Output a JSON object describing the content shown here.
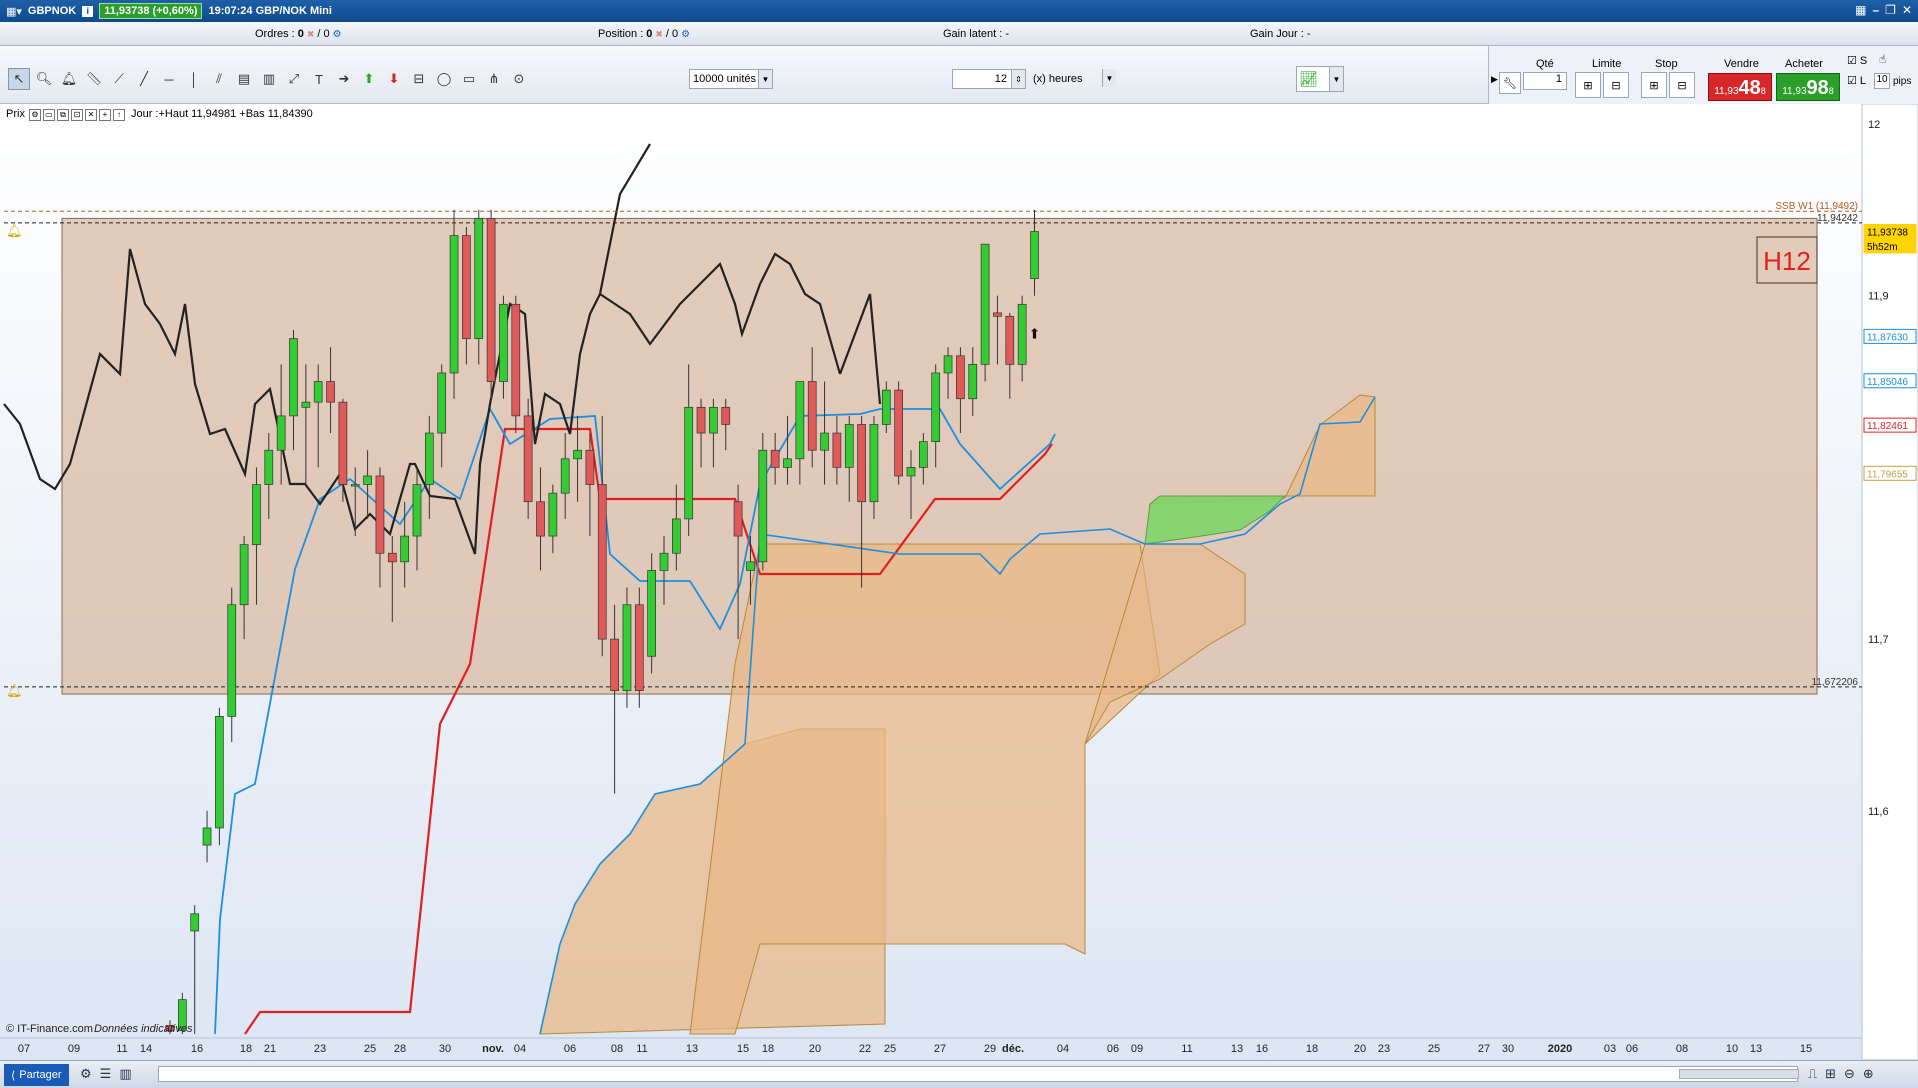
{
  "window": {
    "symbol": "GBPNOK",
    "price_badge": "11,93738 (+0,60%)",
    "time_instrument": "19:07:24 GBP/NOK Mini",
    "info_icon": "i"
  },
  "infobar": {
    "orders_label": "Ordres :",
    "orders_value_1": "0",
    "orders_value_2": "/ 0",
    "position_label": "Position :",
    "position_value_1": "0",
    "position_value_2": "/ 0",
    "gain_latent": "Gain latent : -",
    "gain_jour": "Gain Jour : -"
  },
  "toolbar": {
    "units": "10000 unités",
    "period_value": "12",
    "period_unit": "(x) heures"
  },
  "order_panel": {
    "qte_label": "Qté",
    "qte_value": "1",
    "limite_label": "Limite",
    "stop_label": "Stop",
    "vendre_label": "Vendre",
    "acheter_label": "Acheter",
    "sell_small": "11,93",
    "sell_big": "48",
    "sell_sup": "8",
    "buy_small": "11,93",
    "buy_big": "98",
    "buy_sup": "8",
    "s_label": "S",
    "l_label": "L",
    "pips_value": "10",
    "pips_label": "pips"
  },
  "chart_header": {
    "prix": "Prix",
    "day_info": "Jour :+Haut 11,94981 +Bas 11,84390"
  },
  "chart_data": {
    "type": "candlestick",
    "title": "",
    "timeframe_label": "H12",
    "copyright": "© IT-Finance.com",
    "disclaimer": "Données indicatives",
    "ylim": [
      11.47,
      12.0
    ],
    "y_ticks": [
      "12",
      "11,9",
      "11,7",
      "11,6"
    ],
    "price_tags": [
      {
        "value": "11,93738",
        "color": "#ffd400"
      },
      {
        "value": "5h52m",
        "color": "#ffd400"
      },
      {
        "value": "11,87630",
        "color": "#1b8fe0"
      },
      {
        "value": "11,85046",
        "color": "#1b8fe0"
      },
      {
        "value": "11,82461",
        "color": "#e02020"
      },
      {
        "value": "11,79655",
        "color": "#c8a048"
      }
    ],
    "annotations": [
      {
        "text": "SSB W1 (11,9492)",
        "y": 11.9492
      },
      {
        "text": "11,94242",
        "y": 11.94242
      },
      {
        "text": "11,672206",
        "y": 11.672206
      }
    ],
    "x_ticks": [
      "07",
      "09",
      "11",
      "14",
      "16",
      "18",
      "21",
      "23",
      "25",
      "28",
      "30",
      "nov.",
      "04",
      "06",
      "08",
      "11",
      "13",
      "15",
      "18",
      "20",
      "22",
      "25",
      "27",
      "29",
      "déc.",
      "04",
      "06",
      "09",
      "11",
      "13",
      "16",
      "18",
      "20",
      "23",
      "25",
      "27",
      "30",
      "2020",
      "03",
      "06",
      "08",
      "10",
      "13",
      "15"
    ],
    "candles": [
      {
        "o": 11.475,
        "h": 11.478,
        "l": 11.47,
        "c": 11.472
      },
      {
        "o": 11.472,
        "h": 11.494,
        "l": 11.47,
        "c": 11.49
      },
      {
        "o": 11.53,
        "h": 11.545,
        "l": 11.47,
        "c": 11.54
      },
      {
        "o": 11.58,
        "h": 11.6,
        "l": 11.57,
        "c": 11.59
      },
      {
        "o": 11.59,
        "h": 11.66,
        "l": 11.58,
        "c": 11.655
      },
      {
        "o": 11.655,
        "h": 11.73,
        "l": 11.64,
        "c": 11.72
      },
      {
        "o": 11.72,
        "h": 11.76,
        "l": 11.7,
        "c": 11.755
      },
      {
        "o": 11.755,
        "h": 11.8,
        "l": 11.72,
        "c": 11.79
      },
      {
        "o": 11.79,
        "h": 11.82,
        "l": 11.77,
        "c": 11.81
      },
      {
        "o": 11.81,
        "h": 11.86,
        "l": 11.79,
        "c": 11.83
      },
      {
        "o": 11.83,
        "h": 11.88,
        "l": 11.81,
        "c": 11.875
      },
      {
        "o": 11.835,
        "h": 11.86,
        "l": 11.79,
        "c": 11.838
      },
      {
        "o": 11.838,
        "h": 11.86,
        "l": 11.8,
        "c": 11.85
      },
      {
        "o": 11.85,
        "h": 11.87,
        "l": 11.82,
        "c": 11.838
      },
      {
        "o": 11.838,
        "h": 11.84,
        "l": 11.78,
        "c": 11.79
      },
      {
        "o": 11.79,
        "h": 11.8,
        "l": 11.76,
        "c": 11.79
      },
      {
        "o": 11.79,
        "h": 11.81,
        "l": 11.77,
        "c": 11.795
      },
      {
        "o": 11.795,
        "h": 11.8,
        "l": 11.73,
        "c": 11.75
      },
      {
        "o": 11.75,
        "h": 11.76,
        "l": 11.71,
        "c": 11.745
      },
      {
        "o": 11.745,
        "h": 11.78,
        "l": 11.73,
        "c": 11.76
      },
      {
        "o": 11.76,
        "h": 11.8,
        "l": 11.74,
        "c": 11.79
      },
      {
        "o": 11.79,
        "h": 11.83,
        "l": 11.77,
        "c": 11.82
      },
      {
        "o": 11.82,
        "h": 11.86,
        "l": 11.8,
        "c": 11.855
      },
      {
        "o": 11.855,
        "h": 11.95,
        "l": 11.84,
        "c": 11.935
      },
      {
        "o": 11.935,
        "h": 11.94,
        "l": 11.86,
        "c": 11.875
      },
      {
        "o": 11.875,
        "h": 11.95,
        "l": 11.86,
        "c": 11.945
      },
      {
        "o": 11.945,
        "h": 11.95,
        "l": 11.84,
        "c": 11.85
      },
      {
        "o": 11.85,
        "h": 11.9,
        "l": 11.84,
        "c": 11.895
      },
      {
        "o": 11.895,
        "h": 11.9,
        "l": 11.82,
        "c": 11.83
      },
      {
        "o": 11.83,
        "h": 11.84,
        "l": 11.77,
        "c": 11.78
      },
      {
        "o": 11.78,
        "h": 11.8,
        "l": 11.74,
        "c": 11.76
      },
      {
        "o": 11.76,
        "h": 11.79,
        "l": 11.75,
        "c": 11.785
      },
      {
        "o": 11.785,
        "h": 11.82,
        "l": 11.77,
        "c": 11.805
      },
      {
        "o": 11.805,
        "h": 11.83,
        "l": 11.78,
        "c": 11.81
      },
      {
        "o": 11.81,
        "h": 11.82,
        "l": 11.76,
        "c": 11.79
      },
      {
        "o": 11.79,
        "h": 11.83,
        "l": 11.69,
        "c": 11.7
      },
      {
        "o": 11.7,
        "h": 11.72,
        "l": 11.61,
        "c": 11.67
      },
      {
        "o": 11.67,
        "h": 11.73,
        "l": 11.66,
        "c": 11.72
      },
      {
        "o": 11.72,
        "h": 11.73,
        "l": 11.66,
        "c": 11.67
      },
      {
        "o": 11.69,
        "h": 11.75,
        "l": 11.68,
        "c": 11.74
      },
      {
        "o": 11.74,
        "h": 11.76,
        "l": 11.72,
        "c": 11.75
      },
      {
        "o": 11.75,
        "h": 11.79,
        "l": 11.74,
        "c": 11.77
      },
      {
        "o": 11.77,
        "h": 11.86,
        "l": 11.76,
        "c": 11.835
      },
      {
        "o": 11.835,
        "h": 11.84,
        "l": 11.8,
        "c": 11.82
      },
      {
        "o": 11.82,
        "h": 11.84,
        "l": 11.8,
        "c": 11.835
      },
      {
        "o": 11.835,
        "h": 11.84,
        "l": 11.81,
        "c": 11.825
      },
      {
        "o": 11.78,
        "h": 11.79,
        "l": 11.7,
        "c": 11.76
      },
      {
        "o": 11.74,
        "h": 11.76,
        "l": 11.72,
        "c": 11.745
      },
      {
        "o": 11.745,
        "h": 11.82,
        "l": 11.74,
        "c": 11.81
      },
      {
        "o": 11.81,
        "h": 11.82,
        "l": 11.79,
        "c": 11.8
      },
      {
        "o": 11.8,
        "h": 11.83,
        "l": 11.79,
        "c": 11.805
      },
      {
        "o": 11.805,
        "h": 11.84,
        "l": 11.79,
        "c": 11.85
      },
      {
        "o": 11.85,
        "h": 11.87,
        "l": 11.8,
        "c": 11.81
      },
      {
        "o": 11.81,
        "h": 11.85,
        "l": 11.79,
        "c": 11.82
      },
      {
        "o": 11.82,
        "h": 11.83,
        "l": 11.79,
        "c": 11.8
      },
      {
        "o": 11.8,
        "h": 11.83,
        "l": 11.78,
        "c": 11.825
      },
      {
        "o": 11.825,
        "h": 11.83,
        "l": 11.73,
        "c": 11.78
      },
      {
        "o": 11.78,
        "h": 11.83,
        "l": 11.77,
        "c": 11.825
      },
      {
        "o": 11.825,
        "h": 11.85,
        "l": 11.82,
        "c": 11.845
      },
      {
        "o": 11.845,
        "h": 11.85,
        "l": 11.79,
        "c": 11.795
      },
      {
        "o": 11.795,
        "h": 11.81,
        "l": 11.77,
        "c": 11.8
      },
      {
        "o": 11.8,
        "h": 11.82,
        "l": 11.79,
        "c": 11.815
      },
      {
        "o": 11.815,
        "h": 11.86,
        "l": 11.8,
        "c": 11.855
      },
      {
        "o": 11.855,
        "h": 11.87,
        "l": 11.84,
        "c": 11.865
      },
      {
        "o": 11.865,
        "h": 11.87,
        "l": 11.82,
        "c": 11.84
      },
      {
        "o": 11.84,
        "h": 11.87,
        "l": 11.83,
        "c": 11.86
      },
      {
        "o": 11.86,
        "h": 11.93,
        "l": 11.85,
        "c": 11.93
      },
      {
        "o": 11.89,
        "h": 11.9,
        "l": 11.86,
        "c": 11.888
      },
      {
        "o": 11.888,
        "h": 11.89,
        "l": 11.84,
        "c": 11.86
      },
      {
        "o": 11.86,
        "h": 11.9,
        "l": 11.85,
        "c": 11.895
      },
      {
        "o": 11.91,
        "h": 11.95,
        "l": 11.9,
        "c": 11.93738
      }
    ],
    "series": [
      {
        "name": "tenkan",
        "color": "#1b8fe0",
        "values": []
      },
      {
        "name": "kijun",
        "color": "#e02020",
        "values": []
      },
      {
        "name": "chikou",
        "color": "#000000",
        "values": []
      }
    ]
  },
  "statusbar": {
    "share_label": "Partager"
  },
  "colors": {
    "bull": "#33cc33",
    "bear": "#e05a5a",
    "zone": "#d9b9a0",
    "cloud": "#e9b888",
    "cloud_green": "#7fd46a"
  }
}
